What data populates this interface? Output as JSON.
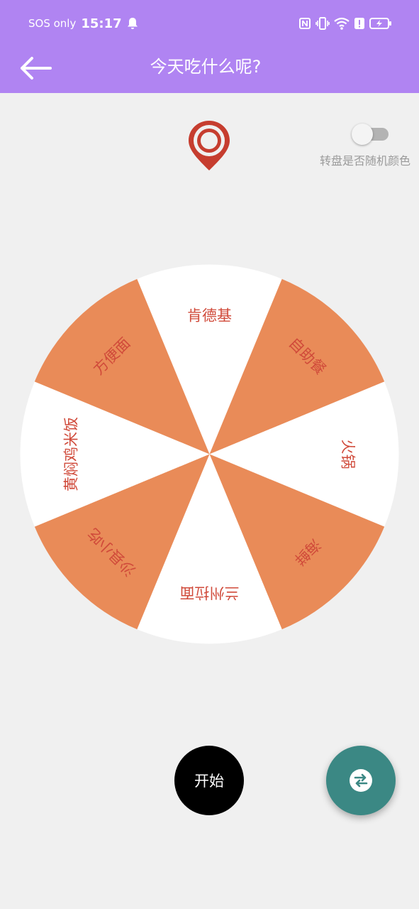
{
  "status_bar": {
    "carrier": "SOS only",
    "time": "15:17",
    "icons": [
      "bell-icon",
      "nfc-icon",
      "vibrate-icon",
      "wifi-icon",
      "alert-icon",
      "battery-charging-icon"
    ]
  },
  "toolbar": {
    "title": "今天吃什么呢?",
    "back_icon": "arrow-left-icon"
  },
  "pointer_icon": "location-pin-icon",
  "random_color_toggle": {
    "label": "转盘是否随机颜色",
    "on": false
  },
  "wheel": {
    "segments": [
      "肯德基",
      "自助餐",
      "火锅",
      "海鲜",
      "兰州拉面",
      "沙县小吃",
      "黄焖鸡米饭",
      "方便面"
    ],
    "colors": [
      "#ffffff",
      "#e98b58"
    ],
    "text_color": "#d04a3a"
  },
  "start_button": {
    "label": "开始"
  },
  "fab": {
    "icon": "swap-arrows-icon",
    "color": "#3b8884"
  },
  "colors": {
    "app_bar": "#b084f2",
    "background": "#f0f0f0",
    "pin": "#c63d2f"
  }
}
